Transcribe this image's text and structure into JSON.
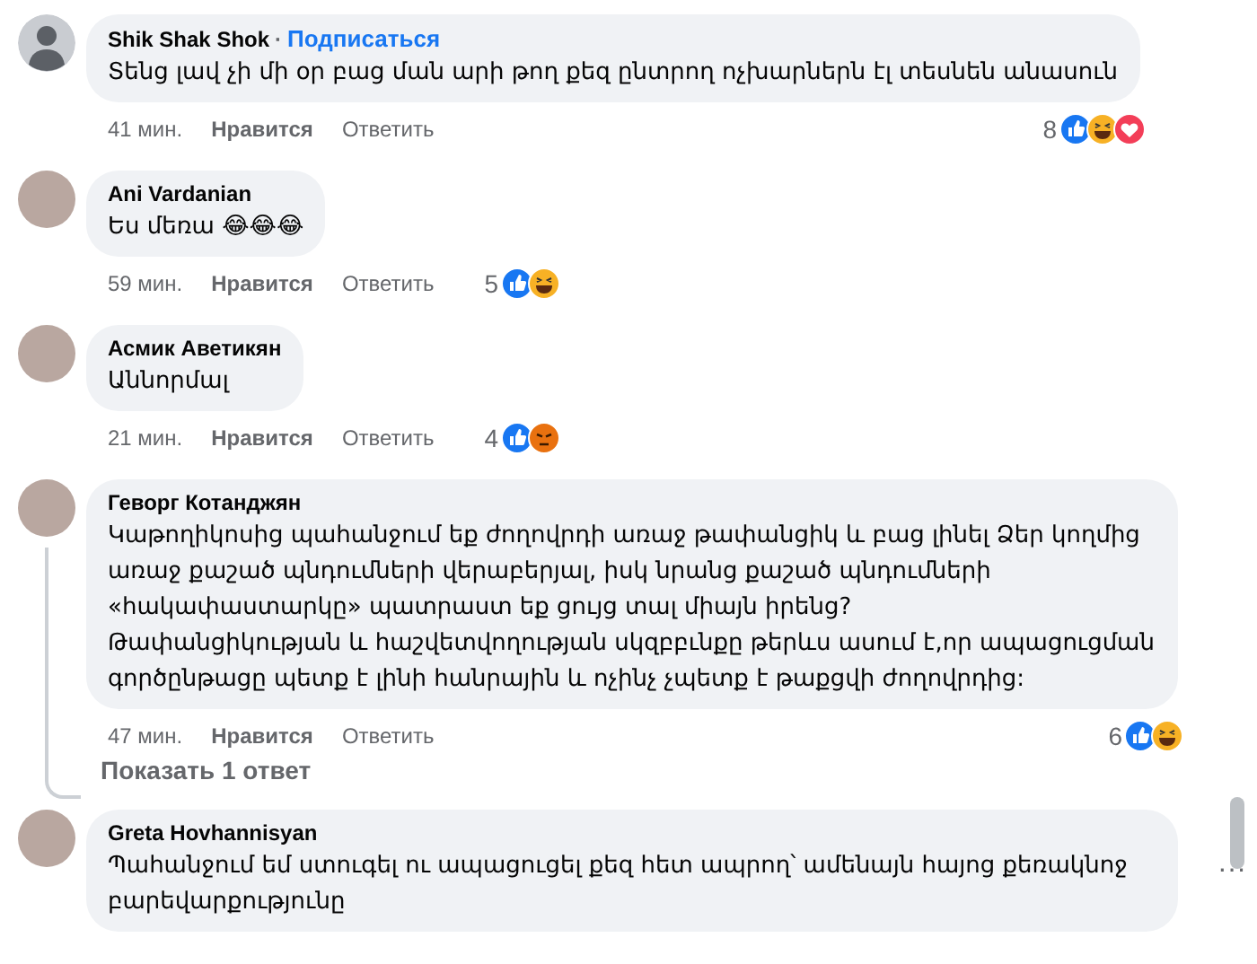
{
  "comments": [
    {
      "author": "Shik Shak Shok",
      "kind": "silhouette",
      "separator": "·",
      "follow_link": "Подписаться",
      "text": "Տենց լավ չի մի օր բաց ման արի թող քեզ ընտրող ոչխարներն էլ տեսնեն անասուն",
      "time": "41 мин.",
      "like_action": "Нравится",
      "reply_action": "Ответить",
      "reaction_count": "8",
      "reactions": [
        {
          "kind": "like"
        },
        {
          "kind": "haha"
        },
        {
          "kind": "love"
        }
      ]
    },
    {
      "author": "Ani Vardanian",
      "kind": "photo",
      "text": "Ես մեռա 😂😂😂",
      "time": "59 мин.",
      "like_action": "Нравится",
      "reply_action": "Ответить",
      "reaction_count": "5",
      "reactions": [
        {
          "kind": "like"
        },
        {
          "kind": "haha"
        }
      ]
    },
    {
      "author": "Асмик Аветикян",
      "kind": "photo",
      "text": "Աննորմալ",
      "time": "21 мин.",
      "like_action": "Нравится",
      "reply_action": "Ответить",
      "reaction_count": "4",
      "reactions": [
        {
          "kind": "like"
        },
        {
          "kind": "angry"
        }
      ]
    },
    {
      "author": "Геворг Котанджян",
      "kind": "photo",
      "text": "Կաթողիկոսից պահանջում եք ժողովրդի առաջ թափանցիկ և բաց լինել Ձեր կողմից առաջ քաշած պնդումների վերաբերյալ, իսկ նրանց քաշած պնդումների «հակափաստարկը» պատրաստ եք ցույց տալ միայն իրենց?\nԹափանցիկության և հաշվետվողության սկզբբւնքը թերևս ասում է,որ ապացուցման գործընթացը պետք է լինի հանրային և ոչինչ չպետք է թաքցվի ժողովրդից:",
      "time": "47 мин.",
      "like_action": "Нравится",
      "reply_action": "Ответить",
      "reaction_count": "6",
      "reactions": [
        {
          "kind": "like"
        },
        {
          "kind": "haha"
        }
      ],
      "show_replies": "Показать 1 ответ"
    },
    {
      "author": "Greta Hovhannisyan",
      "kind": "photo",
      "text": "Պահանջում եմ ստուգել ու ապացուցել քեզ հետ ապրող՝ ամենայն հայոց քեռակնոջ բարեվարքությունը",
      "more_button": "···"
    }
  ]
}
